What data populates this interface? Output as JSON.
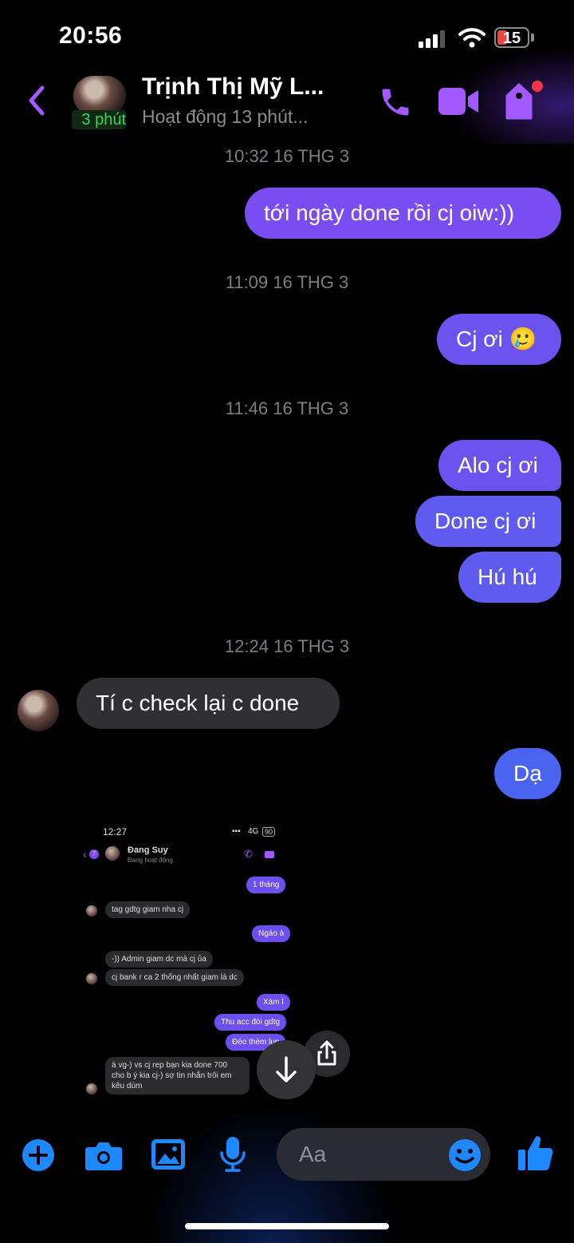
{
  "status_bar": {
    "time": "20:56",
    "battery": "15"
  },
  "header": {
    "contact_name": "Trịnh Thị Mỹ L...",
    "activity": "Hoạt động 13 phút...",
    "avatar_badge": "3 phút"
  },
  "messages": [
    {
      "type": "timestamp",
      "text": "10:32 16 THG 3"
    },
    {
      "type": "outgoing",
      "text": "tới ngày done rồi cj oiw:))"
    },
    {
      "type": "timestamp",
      "text": "11:09 16 THG 3"
    },
    {
      "type": "outgoing",
      "text": "Cj ơi 🥲"
    },
    {
      "type": "timestamp",
      "text": "11:46 16 THG 3"
    },
    {
      "type": "outgoing",
      "text": "Alo cj ơi"
    },
    {
      "type": "outgoing",
      "text": "Done cj ơi"
    },
    {
      "type": "outgoing",
      "text": "Hú hú"
    },
    {
      "type": "timestamp",
      "text": "12:24 16 THG 3"
    },
    {
      "type": "incoming",
      "text": "Tí c check lại c done"
    },
    {
      "type": "outgoing",
      "text": "Dạ"
    }
  ],
  "shared_screenshot": {
    "time": "12:27",
    "network": "4G",
    "battery": "90",
    "back_count": "7",
    "contact_name": "Đang Suy",
    "contact_status": "Đang hoạt động",
    "messages": [
      {
        "type": "outgoing",
        "text": "1 tháng"
      },
      {
        "type": "incoming",
        "text": "tag gdtg giam nha cj"
      },
      {
        "type": "outgoing",
        "text": "Ngáo à"
      },
      {
        "type": "incoming",
        "text": "-)) Admin giam dc mà cj ủa"
      },
      {
        "type": "incoming",
        "text": "cj bank r ca 2 thống nhất giam là dc"
      },
      {
        "type": "outgoing",
        "text": "Xàm l"
      },
      {
        "type": "outgoing",
        "text": "Thu acc đòi gdtg"
      },
      {
        "type": "outgoing",
        "text": "Đéo thèm lun"
      },
      {
        "type": "incoming",
        "lines": [
          "à vg-) vs cj rep bạn kia done 700",
          "cho b ý kia cj-) sợ tin nhắn trôi em",
          "kêu dùm"
        ]
      }
    ]
  },
  "composer": {
    "placeholder": "Aa"
  },
  "colors": {
    "accent": "#a259ff",
    "bottom_icons": "#1e88ff",
    "outgoing_bubble": "#7a4df2",
    "incoming_bubble": "#303033"
  }
}
